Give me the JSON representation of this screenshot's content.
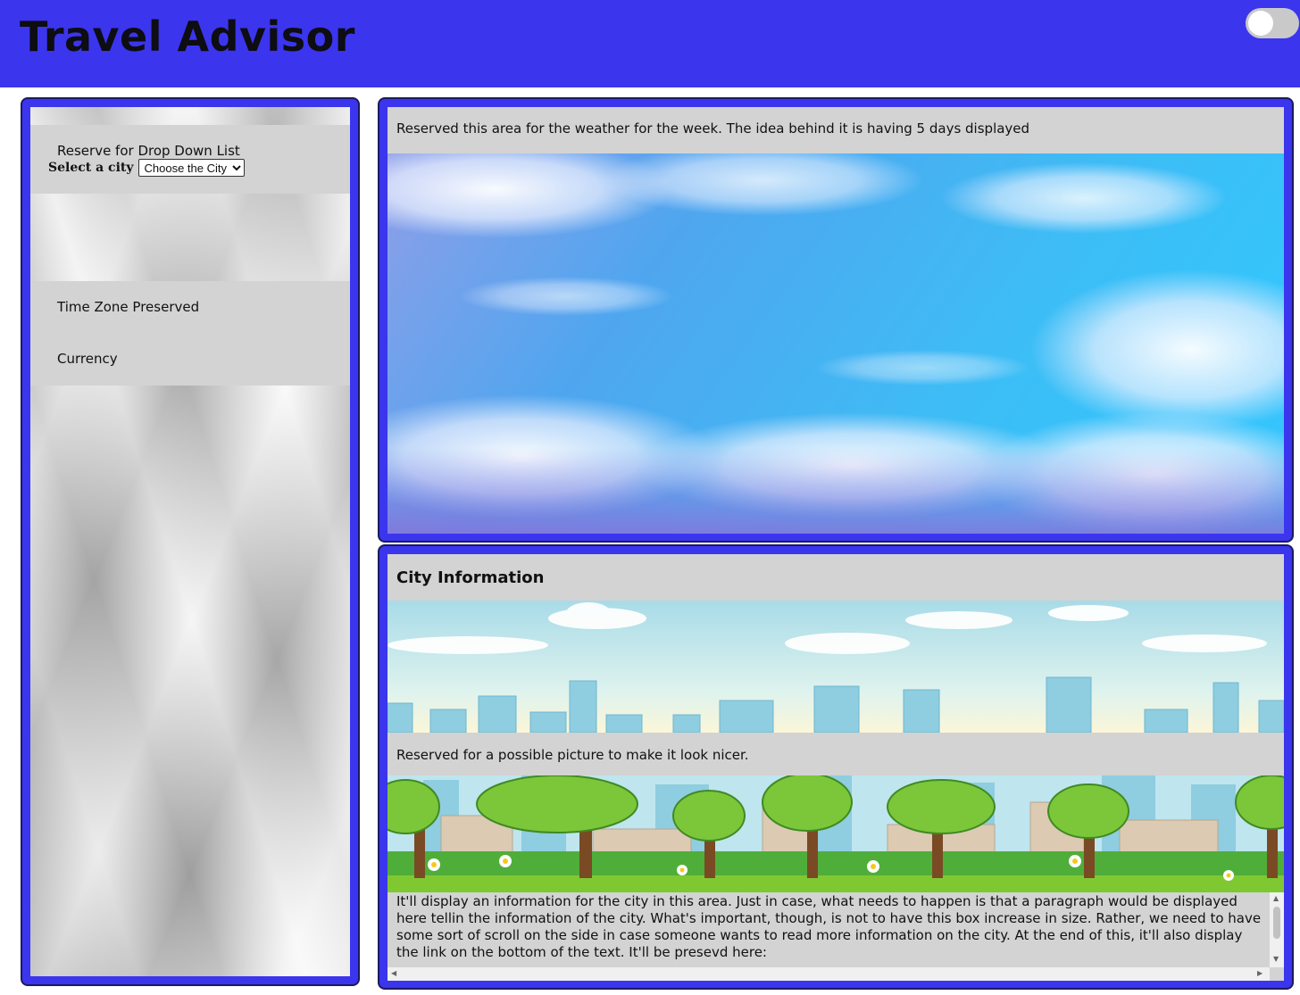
{
  "header": {
    "title": "Travel Advisor",
    "bg_color": "#3b35ee"
  },
  "theme_toggle": {
    "state": "off"
  },
  "sidebar": {
    "dropdown_label": "Reserve for Drop Down List",
    "select_label": "Select a city",
    "select_value": "Choose the City",
    "time_zone_label": "Time Zone Preserved",
    "currency_label": "Currency"
  },
  "weather": {
    "caption": "Reserved this area for the weather for the week. The idea behind it is having 5 days displayed"
  },
  "city_info": {
    "heading": "City Information",
    "picture_caption": "Reserved for a possible picture to make it look nicer.",
    "description": "It'll display an information for the city in this area. Just in case, what needs to happen is that a paragraph would be displayed here tellin the information of the city. What's important, though, is not to have this box increase in size. Rather, we need to have some sort of scroll on the side in case someone wants to read more information on the city. At the end of this, it'll also display the link on the bottom of the text. It'll be presevd here:"
  }
}
